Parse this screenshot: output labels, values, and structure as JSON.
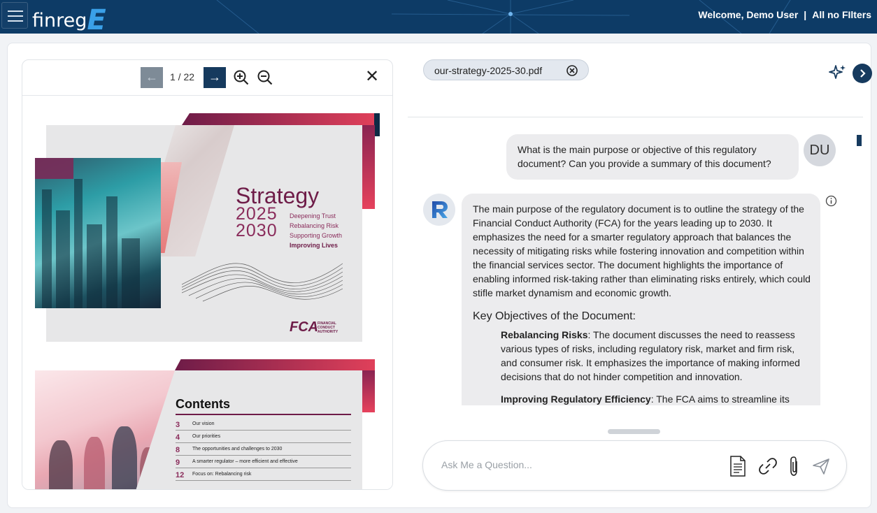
{
  "header": {
    "logo_text": "finreg",
    "logo_mark": "E",
    "welcome": "Welcome, Demo User",
    "separator": "|",
    "filters": "All no FIlters"
  },
  "viewer": {
    "page_indicator": "1 / 22",
    "prev_glyph": "←",
    "next_glyph": "→",
    "close_glyph": "✕",
    "page1": {
      "title": "Strategy",
      "year1": "2025",
      "year2": "2030",
      "lines": [
        "Deepening Trust",
        "Rebalancing Risk",
        "Supporting Growth"
      ],
      "bold_line": "Improving Lives",
      "logo": "FCA",
      "logo_text": [
        "FINANCIAL",
        "CONDUCT",
        "AUTHORITY"
      ]
    },
    "page2": {
      "title": "Contents",
      "toc": [
        {
          "num": "3",
          "text": "Our vision"
        },
        {
          "num": "4",
          "text": "Our priorities"
        },
        {
          "num": "8",
          "text": "The opportunities and challenges to 2030"
        },
        {
          "num": "9",
          "text": "A smarter regulator – more efficient and effective"
        },
        {
          "num": "12",
          "text": "Focus on: Rebalancing risk"
        }
      ]
    }
  },
  "chat": {
    "document_chip": "our-strategy-2025-30.pdf",
    "user_initials": "DU",
    "user_message": "What is the main purpose or objective of this regulatory document? Can you provide a summary of this document?",
    "bot_paragraph": "The main purpose of the regulatory document is to outline the strategy of the Financial Conduct Authority (FCA) for the years leading up to 2030. It emphasizes the need for a smarter regulatory approach that balances the necessity of mitigating risks while fostering innovation and competition within the financial services sector. The document highlights the importance of enabling informed risk-taking rather than eliminating risks entirely, which could stifle market dynamism and economic growth.",
    "bot_heading": "Key Objectives of the Document:",
    "objectives": [
      {
        "title": "Rebalancing Risks",
        "text": ": The document discusses the need to reassess various types of risks, including regulatory risk, market and firm risk, and consumer risk. It emphasizes the importance of making informed decisions that do not hinder competition and innovation."
      },
      {
        "title": "Improving Regulatory Efficiency",
        "text": ": The FCA aims to streamline its"
      }
    ],
    "input_placeholder": "Ask Me a Question..."
  },
  "colors": {
    "header_bg": "#0d3b66",
    "accent_navy": "#163a5e",
    "brand_maroon": "#6e1c48",
    "bubble_bg": "#ececee"
  }
}
